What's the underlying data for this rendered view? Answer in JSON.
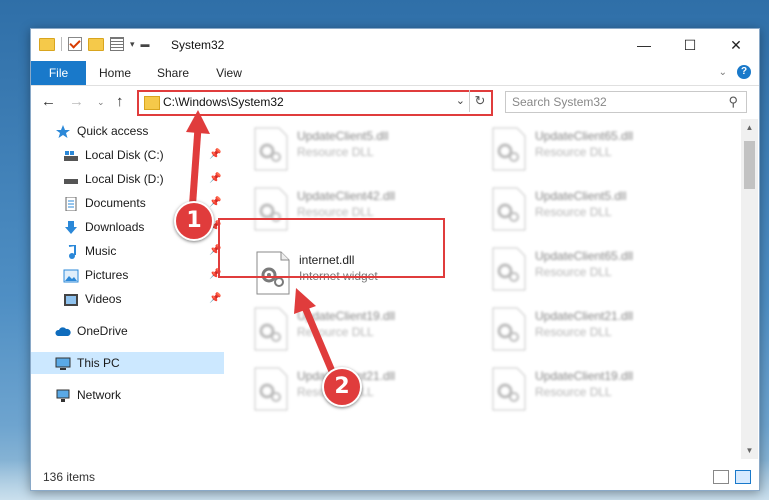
{
  "window": {
    "title": "System32"
  },
  "ribbon": {
    "tabs": [
      "File",
      "Home",
      "Share",
      "View"
    ]
  },
  "address": {
    "path": "C:\\Windows\\System32"
  },
  "search": {
    "placeholder": "Search System32"
  },
  "nav": {
    "items": [
      {
        "label": "Quick access",
        "icon": "star-icon",
        "pinned": false
      },
      {
        "label": "Local Disk (C:)",
        "icon": "drive-icon",
        "pinned": true
      },
      {
        "label": "Local Disk (D:)",
        "icon": "drive-icon",
        "pinned": true
      },
      {
        "label": "Documents",
        "icon": "documents-icon",
        "pinned": true
      },
      {
        "label": "Downloads",
        "icon": "download-icon",
        "pinned": true
      },
      {
        "label": "Music",
        "icon": "music-icon",
        "pinned": true
      },
      {
        "label": "Pictures",
        "icon": "pictures-icon",
        "pinned": true
      },
      {
        "label": "Videos",
        "icon": "videos-icon",
        "pinned": true
      },
      {
        "label": "OneDrive",
        "icon": "cloud-icon",
        "pinned": false
      },
      {
        "label": "This PC",
        "icon": "computer-icon",
        "pinned": false,
        "selected": true
      },
      {
        "label": "Network",
        "icon": "network-icon",
        "pinned": false
      }
    ]
  },
  "files": {
    "col1": [
      {
        "name": "UpdateClient5.dll",
        "desc": "Resource DLL"
      },
      {
        "name": "UpdateClient42.dll",
        "desc": "Resource DLL"
      },
      {
        "name": "internet.dll",
        "desc": "Internet widget"
      },
      {
        "name": "UpdateClient19.dll",
        "desc": "Resource DLL"
      },
      {
        "name": "UpdateClient21.dll",
        "desc": "Resource DLL"
      }
    ],
    "col2": [
      {
        "name": "UpdateClient65.dll",
        "desc": "Resource DLL"
      },
      {
        "name": "UpdateClient5.dll",
        "desc": "Resource DLL"
      },
      {
        "name": "UpdateClient65.dll",
        "desc": "Resource DLL"
      },
      {
        "name": "UpdateClient21.dll",
        "desc": "Resource DLL"
      },
      {
        "name": "UpdateClient19.dll",
        "desc": "Resource DLL"
      }
    ]
  },
  "status": {
    "count": "136 items"
  },
  "callouts": [
    "1",
    "2"
  ],
  "colors": {
    "accent": "#1979ca",
    "highlight": "#e03c3c"
  }
}
